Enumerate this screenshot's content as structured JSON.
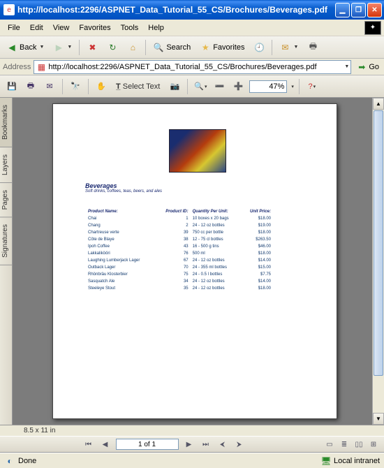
{
  "window": {
    "title": "http://localhost:2296/ASPNET_Data_Tutorial_55_CS/Brochures/Beverages.pdf"
  },
  "menu": {
    "file": "File",
    "edit": "Edit",
    "view": "View",
    "favorites": "Favorites",
    "tools": "Tools",
    "help": "Help"
  },
  "toolbar": {
    "back": "Back",
    "search": "Search",
    "favorites": "Favorites"
  },
  "address": {
    "label": "Address",
    "value": "http://localhost:2296/ASPNET_Data_Tutorial_55_CS/Brochures/Beverages.pdf",
    "go": "Go"
  },
  "pdf": {
    "select_text": "Select Text",
    "zoom": "47%",
    "page_info": "1 of 1",
    "page_dim": "8.5 x 11 in"
  },
  "sidetabs": {
    "bookmarks": "Bookmarks",
    "layers": "Layers",
    "pages": "Pages",
    "signatures": "Signatures"
  },
  "status": {
    "text": "Done",
    "zone": "Local intranet"
  },
  "doc": {
    "title": "Beverages",
    "subtitle": "Soft drinks, coffees, teas, beers, and ales",
    "headers": {
      "name": "Product Name:",
      "id": "Product ID:",
      "qty": "Quantity Per Unit:",
      "price": "Unit Price:"
    }
  },
  "chart_data": {
    "type": "table",
    "columns": [
      "Product Name",
      "Product ID",
      "Quantity Per Unit",
      "Unit Price"
    ],
    "rows": [
      [
        "Chai",
        1,
        "10 boxes x 20 bags",
        "$18.00"
      ],
      [
        "Chang",
        2,
        "24 - 12 oz bottles",
        "$19.00"
      ],
      [
        "Chartreuse verte",
        39,
        "750 cc per bottle",
        "$18.00"
      ],
      [
        "Côte de Blaye",
        38,
        "12 - 75 cl bottles",
        "$263.50"
      ],
      [
        "Ipoh Coffee",
        43,
        "16 - 500 g tins",
        "$46.00"
      ],
      [
        "Lakkalikööri",
        76,
        "500 ml",
        "$18.00"
      ],
      [
        "Laughing Lumberjack Lager",
        67,
        "24 - 12 oz bottles",
        "$14.00"
      ],
      [
        "Outback Lager",
        70,
        "24 - 355 ml bottles",
        "$15.00"
      ],
      [
        "Rhönbräu Klosterbier",
        75,
        "24 - 0.5 l bottles",
        "$7.75"
      ],
      [
        "Sasquatch Ale",
        34,
        "24 - 12 oz bottles",
        "$14.00"
      ],
      [
        "Steeleye Stout",
        35,
        "24 - 12 oz bottles",
        "$18.00"
      ]
    ]
  }
}
